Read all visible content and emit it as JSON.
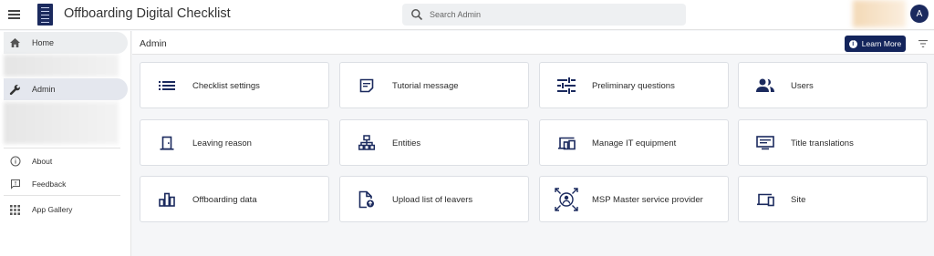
{
  "header": {
    "app_title": "Offboarding Digital Checklist",
    "search_placeholder": "Search Admin",
    "avatar_initial": "A"
  },
  "sidebar": {
    "home_label": "Home",
    "admin_label": "Admin",
    "about_label": "About",
    "feedback_label": "Feedback",
    "app_gallery_label": "App Gallery"
  },
  "main": {
    "page_title": "Admin",
    "learn_more_label": "Learn More",
    "cards": [
      {
        "label": "Checklist settings",
        "icon": "list-icon"
      },
      {
        "label": "Tutorial message",
        "icon": "note-icon"
      },
      {
        "label": "Preliminary questions",
        "icon": "sliders-icon"
      },
      {
        "label": "Users",
        "icon": "users-icon"
      },
      {
        "label": "Leaving reason",
        "icon": "door-icon"
      },
      {
        "label": "Entities",
        "icon": "hierarchy-icon"
      },
      {
        "label": "Manage IT equipment",
        "icon": "devices-icon"
      },
      {
        "label": "Title translations",
        "icon": "subtitles-icon"
      },
      {
        "label": "Offboarding data",
        "icon": "bar-chart-icon"
      },
      {
        "label": "Upload list of leavers",
        "icon": "file-upload-icon"
      },
      {
        "label": "MSP Master service provider",
        "icon": "msp-icon"
      },
      {
        "label": "Site",
        "icon": "site-devices-icon"
      }
    ]
  },
  "colors": {
    "brand_navy": "#13245b",
    "icon_navy": "#1b2a5e",
    "background": "#f5f6f8"
  }
}
